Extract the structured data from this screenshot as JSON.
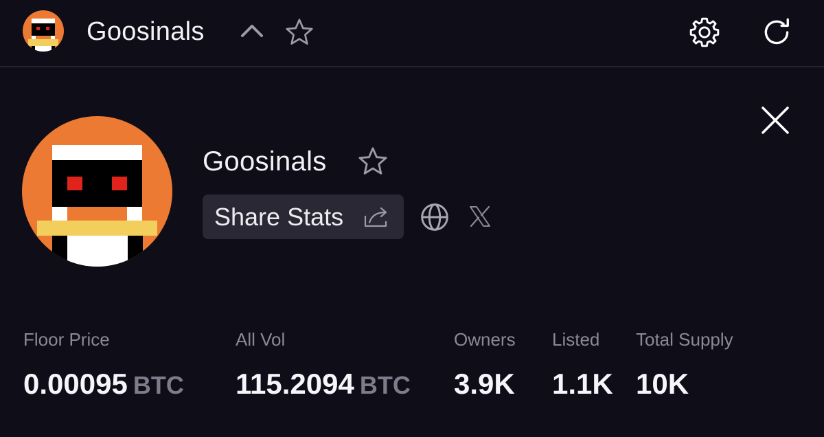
{
  "header": {
    "title": "Goosinals",
    "icons": [
      "collection-avatar",
      "chevron-up-icon",
      "star-icon",
      "gear-icon",
      "refresh-icon"
    ]
  },
  "collection": {
    "name": "Goosinals",
    "share_label": "Share Stats",
    "icons": [
      "close-icon",
      "star-icon",
      "share-icon",
      "globe-icon",
      "x-logo-icon"
    ]
  },
  "stats": [
    {
      "label": "Floor Price",
      "value": "0.00095",
      "unit": "BTC"
    },
    {
      "label": "All Vol",
      "value": "115.2094",
      "unit": "BTC"
    },
    {
      "label": "Owners",
      "value": "3.9K",
      "unit": ""
    },
    {
      "label": "Listed",
      "value": "1.1K",
      "unit": ""
    },
    {
      "label": "Total Supply",
      "value": "10K",
      "unit": ""
    }
  ],
  "colors": {
    "background": "#0f0d18",
    "button_bg": "#2a2834",
    "label": "#8b8997",
    "unit": "#7e7c8a",
    "avatar_orange": "#ec7a32",
    "avatar_yellow": "#f2cf5c",
    "avatar_eye": "#e0241c"
  }
}
